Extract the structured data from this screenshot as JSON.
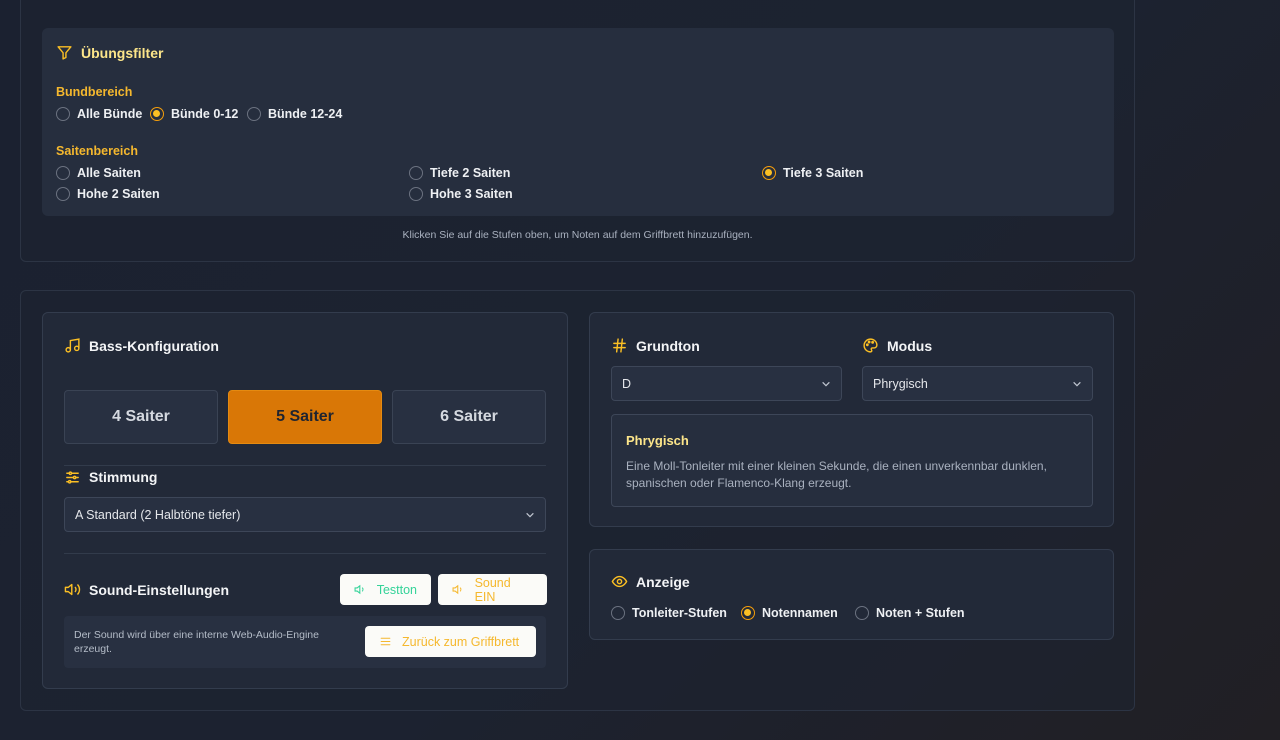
{
  "filter": {
    "title": "Übungsfilter",
    "fret_label": "Bundbereich",
    "fret_options": [
      "Alle Bünde",
      "Bünde 0-12",
      "Bünde 12-24"
    ],
    "fret_selected": "Bünde 0-12",
    "string_label": "Saitenbereich",
    "string_options": [
      "Alle Saiten",
      "Tiefe 2 Saiten",
      "Tiefe 3 Saiten",
      "Hohe 2 Saiten",
      "Hohe 3 Saiten"
    ],
    "string_selected": "Tiefe 3 Saiten",
    "hint": "Klicken Sie auf die Stufen oben, um Noten auf dem Griffbrett hinzuzufügen."
  },
  "bass": {
    "title": "Bass-Konfiguration",
    "options": [
      "4 Saiter",
      "5 Saiter",
      "6 Saiter"
    ],
    "selected": "5 Saiter"
  },
  "tuning": {
    "title": "Stimmung",
    "value": "A Standard (2 Halbtöne tiefer)"
  },
  "sound": {
    "title": "Sound-Einstellungen",
    "test_label": "Testton",
    "toggle_label": "Sound EIN",
    "note": "Der Sound wird über eine interne Web-Audio-Engine erzeugt.",
    "back_label": "Zurück zum Griffbrett"
  },
  "root": {
    "title": "Grundton",
    "value": "D"
  },
  "mode": {
    "title": "Modus",
    "value": "Phrygisch",
    "info_title": "Phrygisch",
    "info_text": "Eine Moll-Tonleiter mit einer kleinen Sekunde, die einen unverkennbar dunklen, spanischen oder Flamenco-Klang erzeugt."
  },
  "display": {
    "title": "Anzeige",
    "options": [
      "Tonleiter-Stufen",
      "Notennamen",
      "Noten + Stufen"
    ],
    "selected": "Notennamen"
  },
  "colors": {
    "accent": "#f59e0b",
    "active_button": "#d97706",
    "testton_text": "#34d399",
    "sound_text": "#f5b82e"
  },
  "icons": [
    "filter-icon",
    "music-note-icon",
    "sliders-icon",
    "speaker-icon",
    "hash-icon",
    "palette-icon",
    "eye-icon",
    "chevron-down-icon"
  ]
}
